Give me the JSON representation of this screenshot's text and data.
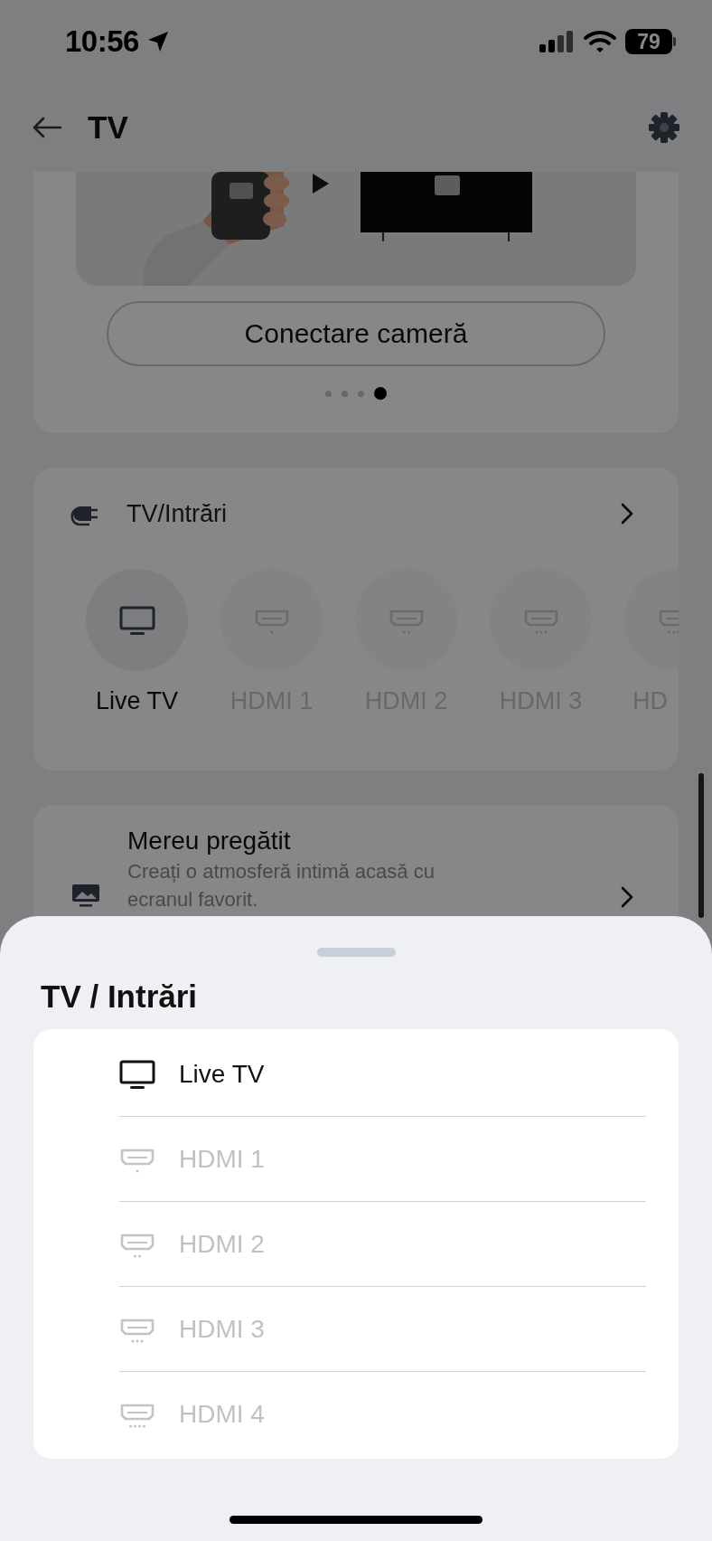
{
  "status_bar": {
    "time": "10:56",
    "battery": "79"
  },
  "header": {
    "title": "TV"
  },
  "camera_card": {
    "button": "Conectare cameră",
    "pages": [
      {
        "selected": false
      },
      {
        "selected": false
      },
      {
        "selected": false
      },
      {
        "selected": true
      }
    ]
  },
  "inputs_card": {
    "title": "TV/Intrări",
    "inputs": [
      {
        "kind": "tv",
        "label": "Live TV",
        "disabled": false
      },
      {
        "kind": "hdmi",
        "label": "HDMI 1",
        "disabled": true
      },
      {
        "kind": "hdmi",
        "label": "HDMI 2",
        "disabled": true
      },
      {
        "kind": "hdmi",
        "label": "HDMI 3",
        "disabled": true
      },
      {
        "kind": "hdmi",
        "label": "HD",
        "disabled": true
      }
    ]
  },
  "ambient_card": {
    "title": "Mereu pregătit",
    "description": "Creați o atmosferă intimă acasă cu ecranul favorit."
  },
  "sheet": {
    "title": "TV / Intrări",
    "items": [
      {
        "kind": "tv",
        "label": "Live TV",
        "disabled": false
      },
      {
        "kind": "hdmi",
        "label": "HDMI 1",
        "disabled": true
      },
      {
        "kind": "hdmi",
        "label": "HDMI 2",
        "disabled": true
      },
      {
        "kind": "hdmi",
        "label": "HDMI 3",
        "disabled": true
      },
      {
        "kind": "hdmi",
        "label": "HDMI 4",
        "disabled": true
      }
    ]
  }
}
